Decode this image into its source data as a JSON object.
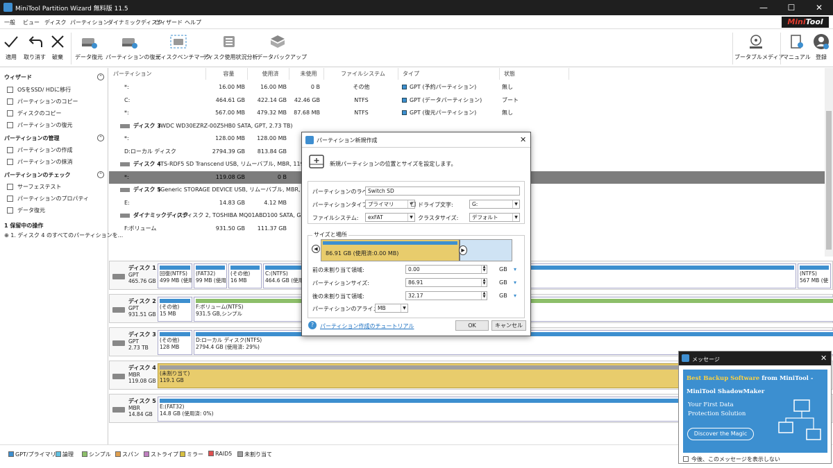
{
  "window": {
    "title": "MiniTool Partition Wizard 無料版 11.5",
    "minimize": "—",
    "maximize": "☐",
    "close": "✕"
  },
  "menu": [
    "一般",
    "ビュー",
    "ディスク",
    "パーティション",
    "ダイナミックディスク",
    "ウィザード",
    "ヘルプ"
  ],
  "logo": {
    "part1": "Mini",
    "part2": "Tool"
  },
  "toolbar": {
    "apply": "適用",
    "undo": "取り消す",
    "discard": "破棄",
    "data_recovery": "データ復元",
    "partition_recovery": "パーティションの復元",
    "disk_benchmark": "ディスクベンチマーク",
    "space_analyzer": "ディスク使用状況分析",
    "backup": "データバックアップ",
    "bootable_media": "ブータブルメディア",
    "manual": "マニュアル",
    "register": "登録"
  },
  "sidebar": {
    "wizard_header": "ウィザード",
    "wizard_items": [
      "OSをSSD/ HDに移行",
      "パーティションのコピー",
      "ディスクのコピー",
      "パーティションの復元"
    ],
    "manage_header": "パーティションの管理",
    "manage_items": [
      "パーティションの作成",
      "パーティションの抹消"
    ],
    "check_header": "パーティションのチェック",
    "check_items": [
      "サーフェステスト",
      "パーティションのプロパティ",
      "データ復元"
    ],
    "pending_header": "1 保留中の操作",
    "pending_item": "1. ディスク 4 のすべてのパーティションを..."
  },
  "grid": {
    "headers": [
      "パーティション",
      "容量",
      "使用済",
      "未使用",
      "ファイルシステム",
      "タイプ",
      "状態"
    ],
    "rows": [
      {
        "kind": "part",
        "name": "*:",
        "cap": "16.00 MB",
        "used": "16.00 MB",
        "free": "0 B",
        "fs": "その他",
        "type": "GPT (予約パーティション)",
        "status": "無し"
      },
      {
        "kind": "part",
        "name": "C:",
        "cap": "464.61 GB",
        "used": "422.14 GB",
        "free": "42.46 GB",
        "fs": "NTFS",
        "type": "GPT (データパーティション)",
        "status": "ブート"
      },
      {
        "kind": "part",
        "name": "*:",
        "cap": "567.00 MB",
        "used": "479.32 MB",
        "free": "87.68 MB",
        "fs": "NTFS",
        "type": "GPT (復元パーティション)",
        "status": "無し"
      },
      {
        "kind": "disk",
        "label": "ディスク 3",
        "desc": "(WDC WD30EZRZ-00Z5HB0 SATA, GPT, 2.73 TB)"
      },
      {
        "kind": "part",
        "name": "*:",
        "cap": "128.00 MB",
        "used": "128.00 MB",
        "free": "",
        "fs": "",
        "type": "",
        "status": ""
      },
      {
        "kind": "part",
        "name": "D:ローカル ディスク",
        "cap": "2794.39 GB",
        "used": "813.84 GB",
        "free": "198",
        "fs": "",
        "type": "",
        "status": ""
      },
      {
        "kind": "disk",
        "label": "ディスク 4",
        "desc": "(TS-RDF5 SD Transcend USB, リムーバブル, MBR, 119.08 GB)"
      },
      {
        "kind": "sel",
        "name": "*:",
        "cap": "119.08 GB",
        "used": "0 B",
        "free": "11",
        "fs": "",
        "type": "",
        "status": ""
      },
      {
        "kind": "disk",
        "label": "ディスク 5",
        "desc": "(Generic STORAGE DEVICE USB, リムーバブル, MBR, 14.84 GB)"
      },
      {
        "kind": "part",
        "name": "E:",
        "cap": "14.83 GB",
        "used": "4.12 MB",
        "free": "1",
        "fs": "",
        "type": "",
        "status": ""
      },
      {
        "kind": "disk",
        "label": "ダイナミックディスク",
        "desc": "(\"ディスク 2, TOSHIBA MQ01ABD100 SATA, GPT, 931.51 GB\")"
      },
      {
        "kind": "part",
        "name": "F:ボリューム",
        "cap": "931.50 GB",
        "used": "111.37 GB",
        "free": "820",
        "fs": "",
        "type": "",
        "status": ""
      }
    ]
  },
  "diskmap": [
    {
      "name": "ディスク 1",
      "style": "GPT",
      "size": "465.76 GB",
      "parts": [
        {
          "l1": "回復(NTFS)",
          "l2": "499 MB (使用",
          "color": "#3d8fcf"
        },
        {
          "l1": "(FAT32)",
          "l2": "99 MB (使用",
          "color": "#3d8fcf"
        },
        {
          "l1": "(その他)",
          "l2": "16 MB",
          "color": "#3d8fcf"
        },
        {
          "l1": "C:(NTFS)",
          "l2": "464.6 GB (使用",
          "color": "#3d8fcf"
        },
        {
          "l1": "(NTFS)",
          "l2": "567 MB (使",
          "color": "#3d8fcf"
        }
      ]
    },
    {
      "name": "ディスク 2",
      "style": "GPT",
      "size": "931.51 GB",
      "parts": [
        {
          "l1": "(その他)",
          "l2": "15 MB",
          "color": "#3d8fcf"
        },
        {
          "l1": "F:ボリューム(NTFS)",
          "l2": "931.5 GB,シンプル",
          "color": "#8dbf6a"
        }
      ]
    },
    {
      "name": "ディスク 3",
      "style": "GPT",
      "size": "2.73 TB",
      "parts": [
        {
          "l1": "(その他)",
          "l2": "128 MB",
          "color": "#3d8fcf"
        },
        {
          "l1": "D:ローカル ディスク(NTFS)",
          "l2": "2794.4 GB (使用済: 29%)",
          "color": "#3d8fcf"
        }
      ]
    },
    {
      "name": "ディスク 4",
      "style": "MBR",
      "size": "119.08 GB",
      "parts": [
        {
          "l1": "(未割り当て)",
          "l2": "119.1 GB",
          "color": "#a0a0a0"
        }
      ]
    },
    {
      "name": "ディスク 5",
      "style": "MBR",
      "size": "14.84 GB",
      "parts": [
        {
          "l1": "E:(FAT32)",
          "l2": "14.8 GB (使用済: 0%)",
          "color": "#3d8fcf"
        }
      ]
    }
  ],
  "legend": [
    {
      "label": "GPT/プライマリ",
      "color": "#3d8fcf"
    },
    {
      "label": "論理",
      "color": "#60c0e0"
    },
    {
      "label": "シンプル",
      "color": "#8dbf6a"
    },
    {
      "label": "スパン",
      "color": "#e0a050"
    },
    {
      "label": "ストライプ",
      "color": "#c080c0"
    },
    {
      "label": "ミラー",
      "color": "#d8c040"
    },
    {
      "label": "RAID5",
      "color": "#e05050"
    },
    {
      "label": "未割り当て",
      "color": "#a0a0a0"
    }
  ],
  "dialog": {
    "title": "パーティション新規作成",
    "intro": "新規パーティションの位置とサイズを設定します。",
    "label_label": "パーティションのラベル:",
    "label_value": "Switch SD",
    "type_label": "パーティションタイプ:",
    "type_value": "プライマリ",
    "drive_label": "ドライブ文字:",
    "drive_value": "G:",
    "fs_label": "ファイルシステム:",
    "fs_value": "exFAT",
    "cluster_label": "クラスタサイズ:",
    "cluster_value": "デフォルト",
    "size_group": "サイズと場所",
    "bar_text": "86.91 GB (使用済:0.00 MB)",
    "bar_fill": 0.73,
    "before_label": "前の未割り当て領域:",
    "before_value": "0.00",
    "size_label": "パーティションサイズ:",
    "size_value": "86.91",
    "after_label": "後の未割り当て領域:",
    "after_value": "32.17",
    "unit": "GB",
    "align_label": "パーティションのアライメント:",
    "align_value": "MB",
    "tutorial": "パーティション作成のチュートリアル",
    "ok": "OK",
    "cancel": "キャンセル"
  },
  "message": {
    "title": "メッセージ",
    "headline1": "Best Backup Software",
    "headline2": "from MiniTool -",
    "product": "MiniTool ShadowMaker",
    "sub1": "Your First Data",
    "sub2": "Protection Solution",
    "button": "Discover the Magic",
    "checkbox": "今後、このメッセージを表示しない"
  }
}
